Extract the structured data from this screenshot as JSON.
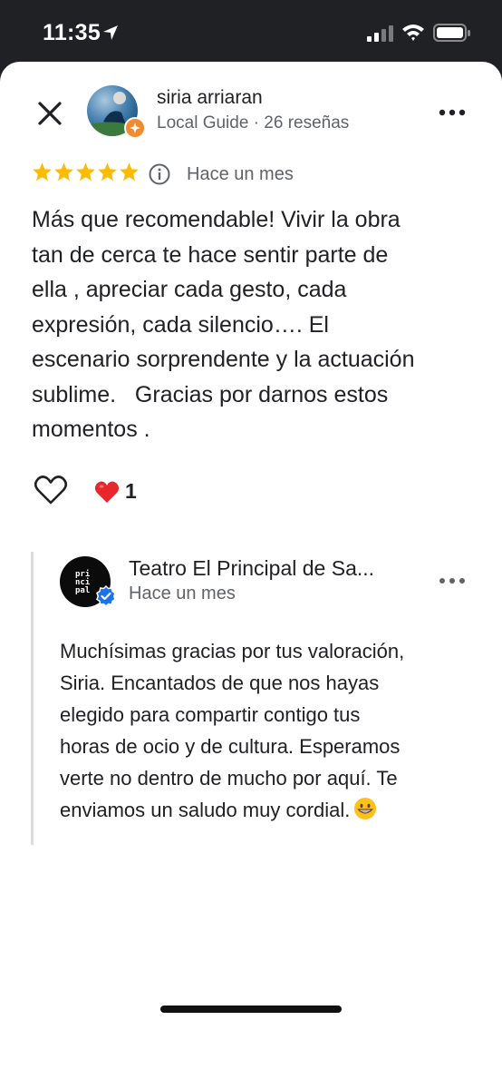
{
  "status_bar": {
    "time": "11:35"
  },
  "review": {
    "reviewer_name": "siria arriaran",
    "reviewer_meta": "Local Guide · 26 reseñas",
    "rating": 5,
    "date": "Hace un mes",
    "text": "Más que recomendable! Vivir la obra\ntan de cerca te hace sentir parte de\nella , apreciar cada gesto, cada\nexpresión, cada silencio…. El\nescenario sorprendente y la actuación\nsublime.   Gracias por darnos estos\nmomentos .",
    "reaction_count": "1"
  },
  "owner_reply": {
    "business_name": "Teatro El Principal de Sa...",
    "logo_text": "pri\nnci\npal",
    "date": "Hace un mes",
    "text": "Muchísimas gracias por tus valoración,\nSiria. Encantados de que nos hayas\nelegido para compartir contigo tus\nhoras de ocio y de cultura. Esperamos\nverte no dentro de mucho por aquí. Te\nenviamos un saludo muy cordial."
  },
  "icons": {
    "close": "close-icon",
    "more": "more-horiz-icon",
    "star": "star-icon",
    "info": "info-icon",
    "like": "heart-outline-icon",
    "reaction": "red-heart-icon",
    "verified": "verified-check-icon",
    "emoji": "grinning-face-emoji"
  },
  "colors": {
    "star": "#fbbc04",
    "local_guide_badge": "#f28b30",
    "verified": "#1a73e8",
    "reaction_heart": "#e8262c"
  }
}
